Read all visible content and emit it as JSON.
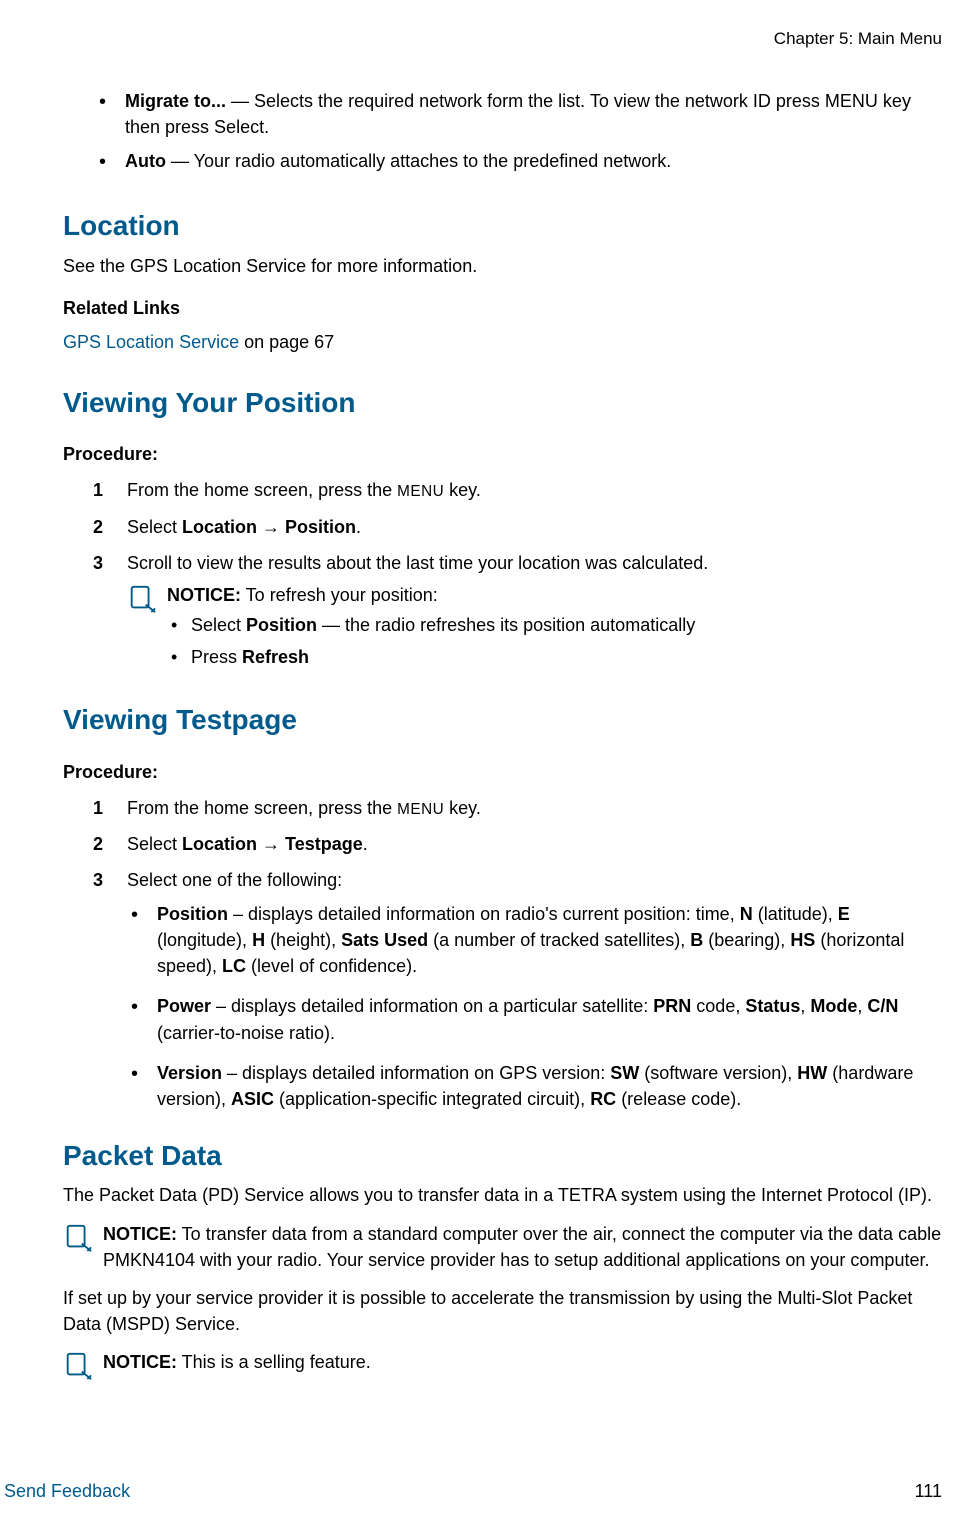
{
  "header": {
    "chapter": "Chapter 5: Main Menu"
  },
  "top_bullets": {
    "migrate_label": "Migrate to...",
    "migrate_text": " — Selects the required network form the list. To view the network ID press MENU key then press Select.",
    "auto_label": "Auto",
    "auto_text": " — Your radio automatically attaches to the predefined network."
  },
  "location": {
    "heading": "Location",
    "body": "See the GPS Location Service for more information.",
    "related_links_label": "Related Links",
    "link_text": "GPS Location Service",
    "link_suffix": " on page 67"
  },
  "viewing_position": {
    "heading": "Viewing Your Position",
    "procedure_label": "Procedure:",
    "step1_pre": "From the home screen, press the ",
    "step1_menu": "MENU",
    "step1_post": " key.",
    "step2_pre": "Select ",
    "step2_path": "Location → Position",
    "step2_post": ".",
    "step3": "Scroll to view the results about the last time your location was calculated.",
    "notice_label": "NOTICE:",
    "notice_intro": " To refresh your position:",
    "notice_b1_pre": "Select ",
    "notice_b1_bold": "Position",
    "notice_b1_post": " — the radio refreshes its position automatically",
    "notice_b2_pre": "Press ",
    "notice_b2_bold": "Refresh"
  },
  "viewing_testpage": {
    "heading": "Viewing Testpage",
    "procedure_label": "Procedure:",
    "step1_pre": "From the home screen, press the ",
    "step1_menu": "MENU",
    "step1_post": " key.",
    "step2_pre": "Select ",
    "step2_path": "Location → Testpage",
    "step2_post": ".",
    "step3": "Select one of the following:",
    "pos_label": "Position",
    "pos_t1": " – displays detailed information on radio's current position: time, ",
    "pos_N": "N",
    "pos_t2": " (latitude), ",
    "pos_E": "E",
    "pos_t3": " (longitude), ",
    "pos_H": "H",
    "pos_t4": " (height), ",
    "pos_Sats": "Sats Used",
    "pos_t5": " (a number of tracked satellites), ",
    "pos_B": "B",
    "pos_t6": " (bearing), ",
    "pos_HS": "HS",
    "pos_t7": " (horizontal speed), ",
    "pos_LC": "LC",
    "pos_t8": " (level of confidence).",
    "pow_label": "Power",
    "pow_t1": " – displays detailed information on a particular satellite: ",
    "pow_PRN": "PRN",
    "pow_t2": " code, ",
    "pow_Status": "Status",
    "pow_c1": ", ",
    "pow_Mode": "Mode",
    "pow_c2": ", ",
    "pow_CN": "C/N",
    "pow_t3": " (carrier-to-noise ratio).",
    "ver_label": "Version",
    "ver_t1": " – displays detailed information on GPS version: ",
    "ver_SW": "SW",
    "ver_t2": " (software version), ",
    "ver_HW": "HW",
    "ver_t3": " (hardware version), ",
    "ver_ASIC": "ASIC",
    "ver_t4": " (application-specific integrated circuit), ",
    "ver_RC": "RC",
    "ver_t5": " (release code)."
  },
  "packet_data": {
    "heading": "Packet Data",
    "intro": "The Packet Data (PD) Service allows you to transfer data in a TETRA system using the Internet Protocol (IP).",
    "notice1_label": "NOTICE:",
    "notice1_text": " To transfer data from a standard computer over the air, connect the computer via the data cable PMKN4104 with your radio. Your service provider has to setup additional applications on your computer.",
    "body2": "If set up by your service provider it is possible to accelerate the transmission by using the Multi-Slot Packet Data (MSPD) Service.",
    "notice2_label": "NOTICE:",
    "notice2_text": " This is a selling feature."
  },
  "footer": {
    "feedback": "Send Feedback",
    "page": "111"
  }
}
